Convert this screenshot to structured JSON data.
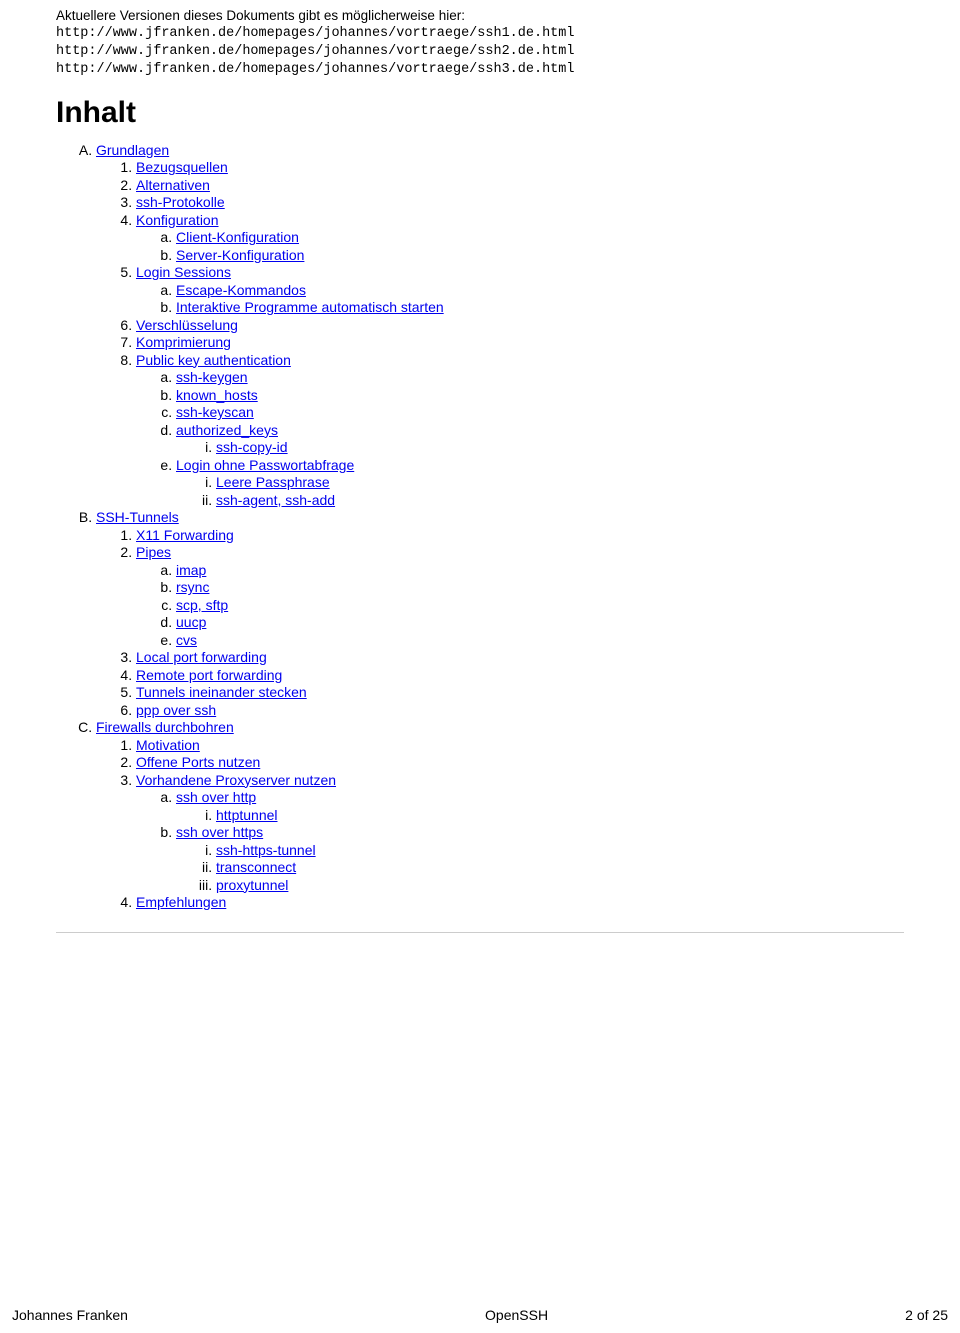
{
  "notice": "Aktuellere Versionen dieses Dokuments gibt es möglicherweise hier:",
  "urls": [
    "http://www.jfranken.de/homepages/johannes/vortraege/ssh1.de.html",
    "http://www.jfranken.de/homepages/johannes/vortraege/ssh2.de.html",
    "http://www.jfranken.de/homepages/johannes/vortraege/ssh3.de.html"
  ],
  "heading": "Inhalt",
  "toc": {
    "A": {
      "label": "Grundlagen",
      "items": {
        "1": {
          "label": "Bezugsquellen"
        },
        "2": {
          "label": "Alternativen"
        },
        "3": {
          "label": "ssh-Protokolle"
        },
        "4": {
          "label": "Konfiguration",
          "sub": {
            "a": "Client-Konfiguration",
            "b": "Server-Konfiguration"
          }
        },
        "5": {
          "label": "Login Sessions",
          "sub": {
            "a": "Escape-Kommandos",
            "b": "Interaktive Programme automatisch starten"
          }
        },
        "6": {
          "label": "Verschlüsselung"
        },
        "7": {
          "label": "Komprimierung"
        },
        "8": {
          "label": "Public key authentication",
          "sub": {
            "a": "ssh-keygen",
            "b": "known_hosts",
            "c": "ssh-keyscan",
            "d": {
              "label": "authorized_keys",
              "sub": {
                "i": "ssh-copy-id"
              }
            },
            "e": {
              "label": "Login ohne Passwortabfrage",
              "sub": {
                "i": "Leere Passphrase",
                "ii": "ssh-agent, ssh-add"
              }
            }
          }
        }
      }
    },
    "B": {
      "label": "SSH-Tunnels",
      "items": {
        "1": {
          "label": "X11 Forwarding"
        },
        "2": {
          "label": "Pipes",
          "sub": {
            "a": "imap",
            "b": "rsync",
            "c": "scp, sftp",
            "d": "uucp",
            "e": "cvs"
          }
        },
        "3": {
          "label": "Local port forwarding"
        },
        "4": {
          "label": "Remote port forwarding"
        },
        "5": {
          "label": "Tunnels ineinander stecken"
        },
        "6": {
          "label": "ppp over ssh"
        }
      }
    },
    "C": {
      "label": "Firewalls durchbohren",
      "items": {
        "1": {
          "label": "Motivation"
        },
        "2": {
          "label": "Offene Ports nutzen"
        },
        "3": {
          "label": "Vorhandene Proxyserver nutzen",
          "sub": {
            "a": {
              "label": "ssh over http",
              "sub": {
                "i": "httptunnel"
              }
            },
            "b": {
              "label": "ssh over https",
              "sub": {
                "i": "ssh-https-tunnel",
                "ii": "transconnect",
                "iii": "proxytunnel"
              }
            }
          }
        },
        "4": {
          "label": "Empfehlungen"
        }
      }
    }
  },
  "footer": {
    "author": "Johannes Franken",
    "title": "OpenSSH",
    "page": "2 of 25"
  }
}
